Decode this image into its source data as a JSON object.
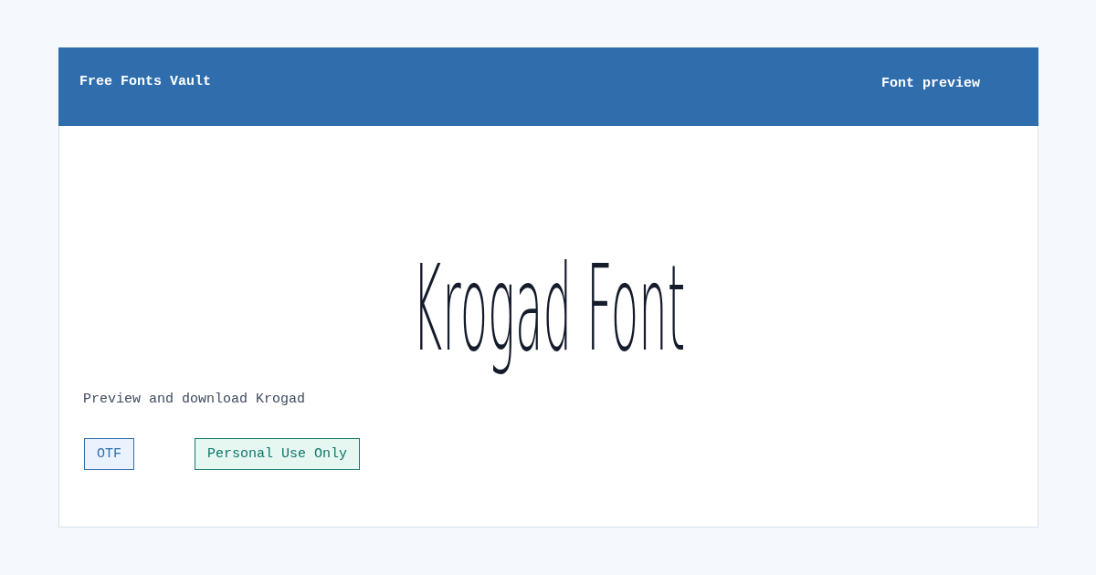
{
  "header": {
    "site_title": "Free Fonts Vault",
    "page_label": "Font preview"
  },
  "preview": {
    "sample_text": "Krogad Font",
    "subtitle": "Preview and download Krogad"
  },
  "tags": [
    {
      "kind": "format",
      "label": "OTF"
    },
    {
      "kind": "license",
      "label": "Personal Use Only"
    }
  ]
}
